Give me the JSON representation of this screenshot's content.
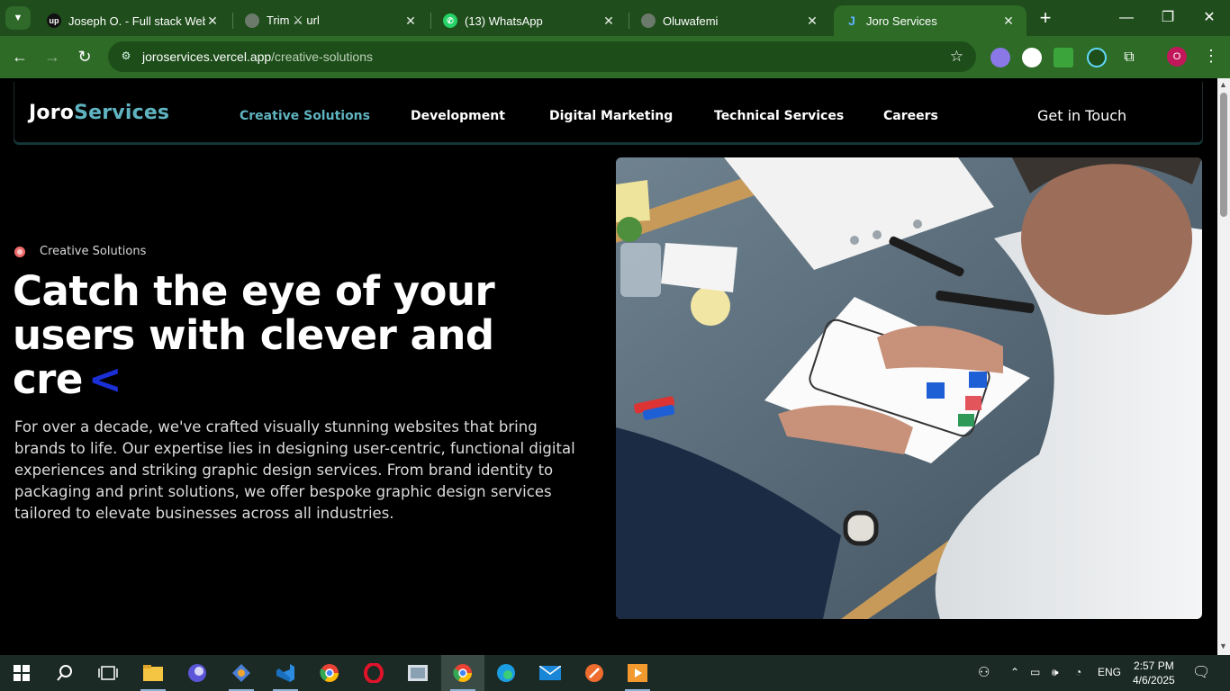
{
  "browser": {
    "tabs": [
      {
        "title": "Joseph O. - Full stack Web d",
        "favicon": "upwork-icon"
      },
      {
        "title": "Trim ⚔ url",
        "favicon": "globe-icon"
      },
      {
        "title": "(13) WhatsApp",
        "favicon": "whatsapp-icon"
      },
      {
        "title": "Oluwafemi",
        "favicon": "globe-icon"
      },
      {
        "title": "Joro Services",
        "favicon": "joro-icon",
        "active": true
      }
    ],
    "url_host": "joroservices.vercel.app",
    "url_path": "/creative-solutions",
    "profile_initial": "O"
  },
  "site": {
    "logo_part1": "Joro",
    "logo_part2": "Services",
    "nav": [
      {
        "label": "Creative Solutions",
        "active": true
      },
      {
        "label": "Development"
      },
      {
        "label": "Digital Marketing"
      },
      {
        "label": "Technical Services"
      },
      {
        "label": "Careers"
      }
    ],
    "cta": "Get in Touch",
    "colors": {
      "accent": "#5fb3c0",
      "caret": "#1a2fd6",
      "dot": "#f06b6b"
    }
  },
  "hero": {
    "eyebrow": "Creative Solutions",
    "headline_line1": "Catch the eye of your",
    "headline_line2": "users with clever and cre",
    "caret": "<",
    "description": "For over a decade, we've crafted visually stunning websites that bring brands to life. Our expertise lies in designing user-centric, functional digital experiences and striking graphic design services. From brand identity to packaging and print solutions, we offer bespoke graphic design services tailored to elevate businesses across all industries."
  },
  "taskbar": {
    "language": "ENG",
    "time": "2:57 PM",
    "date": "4/6/2025"
  }
}
